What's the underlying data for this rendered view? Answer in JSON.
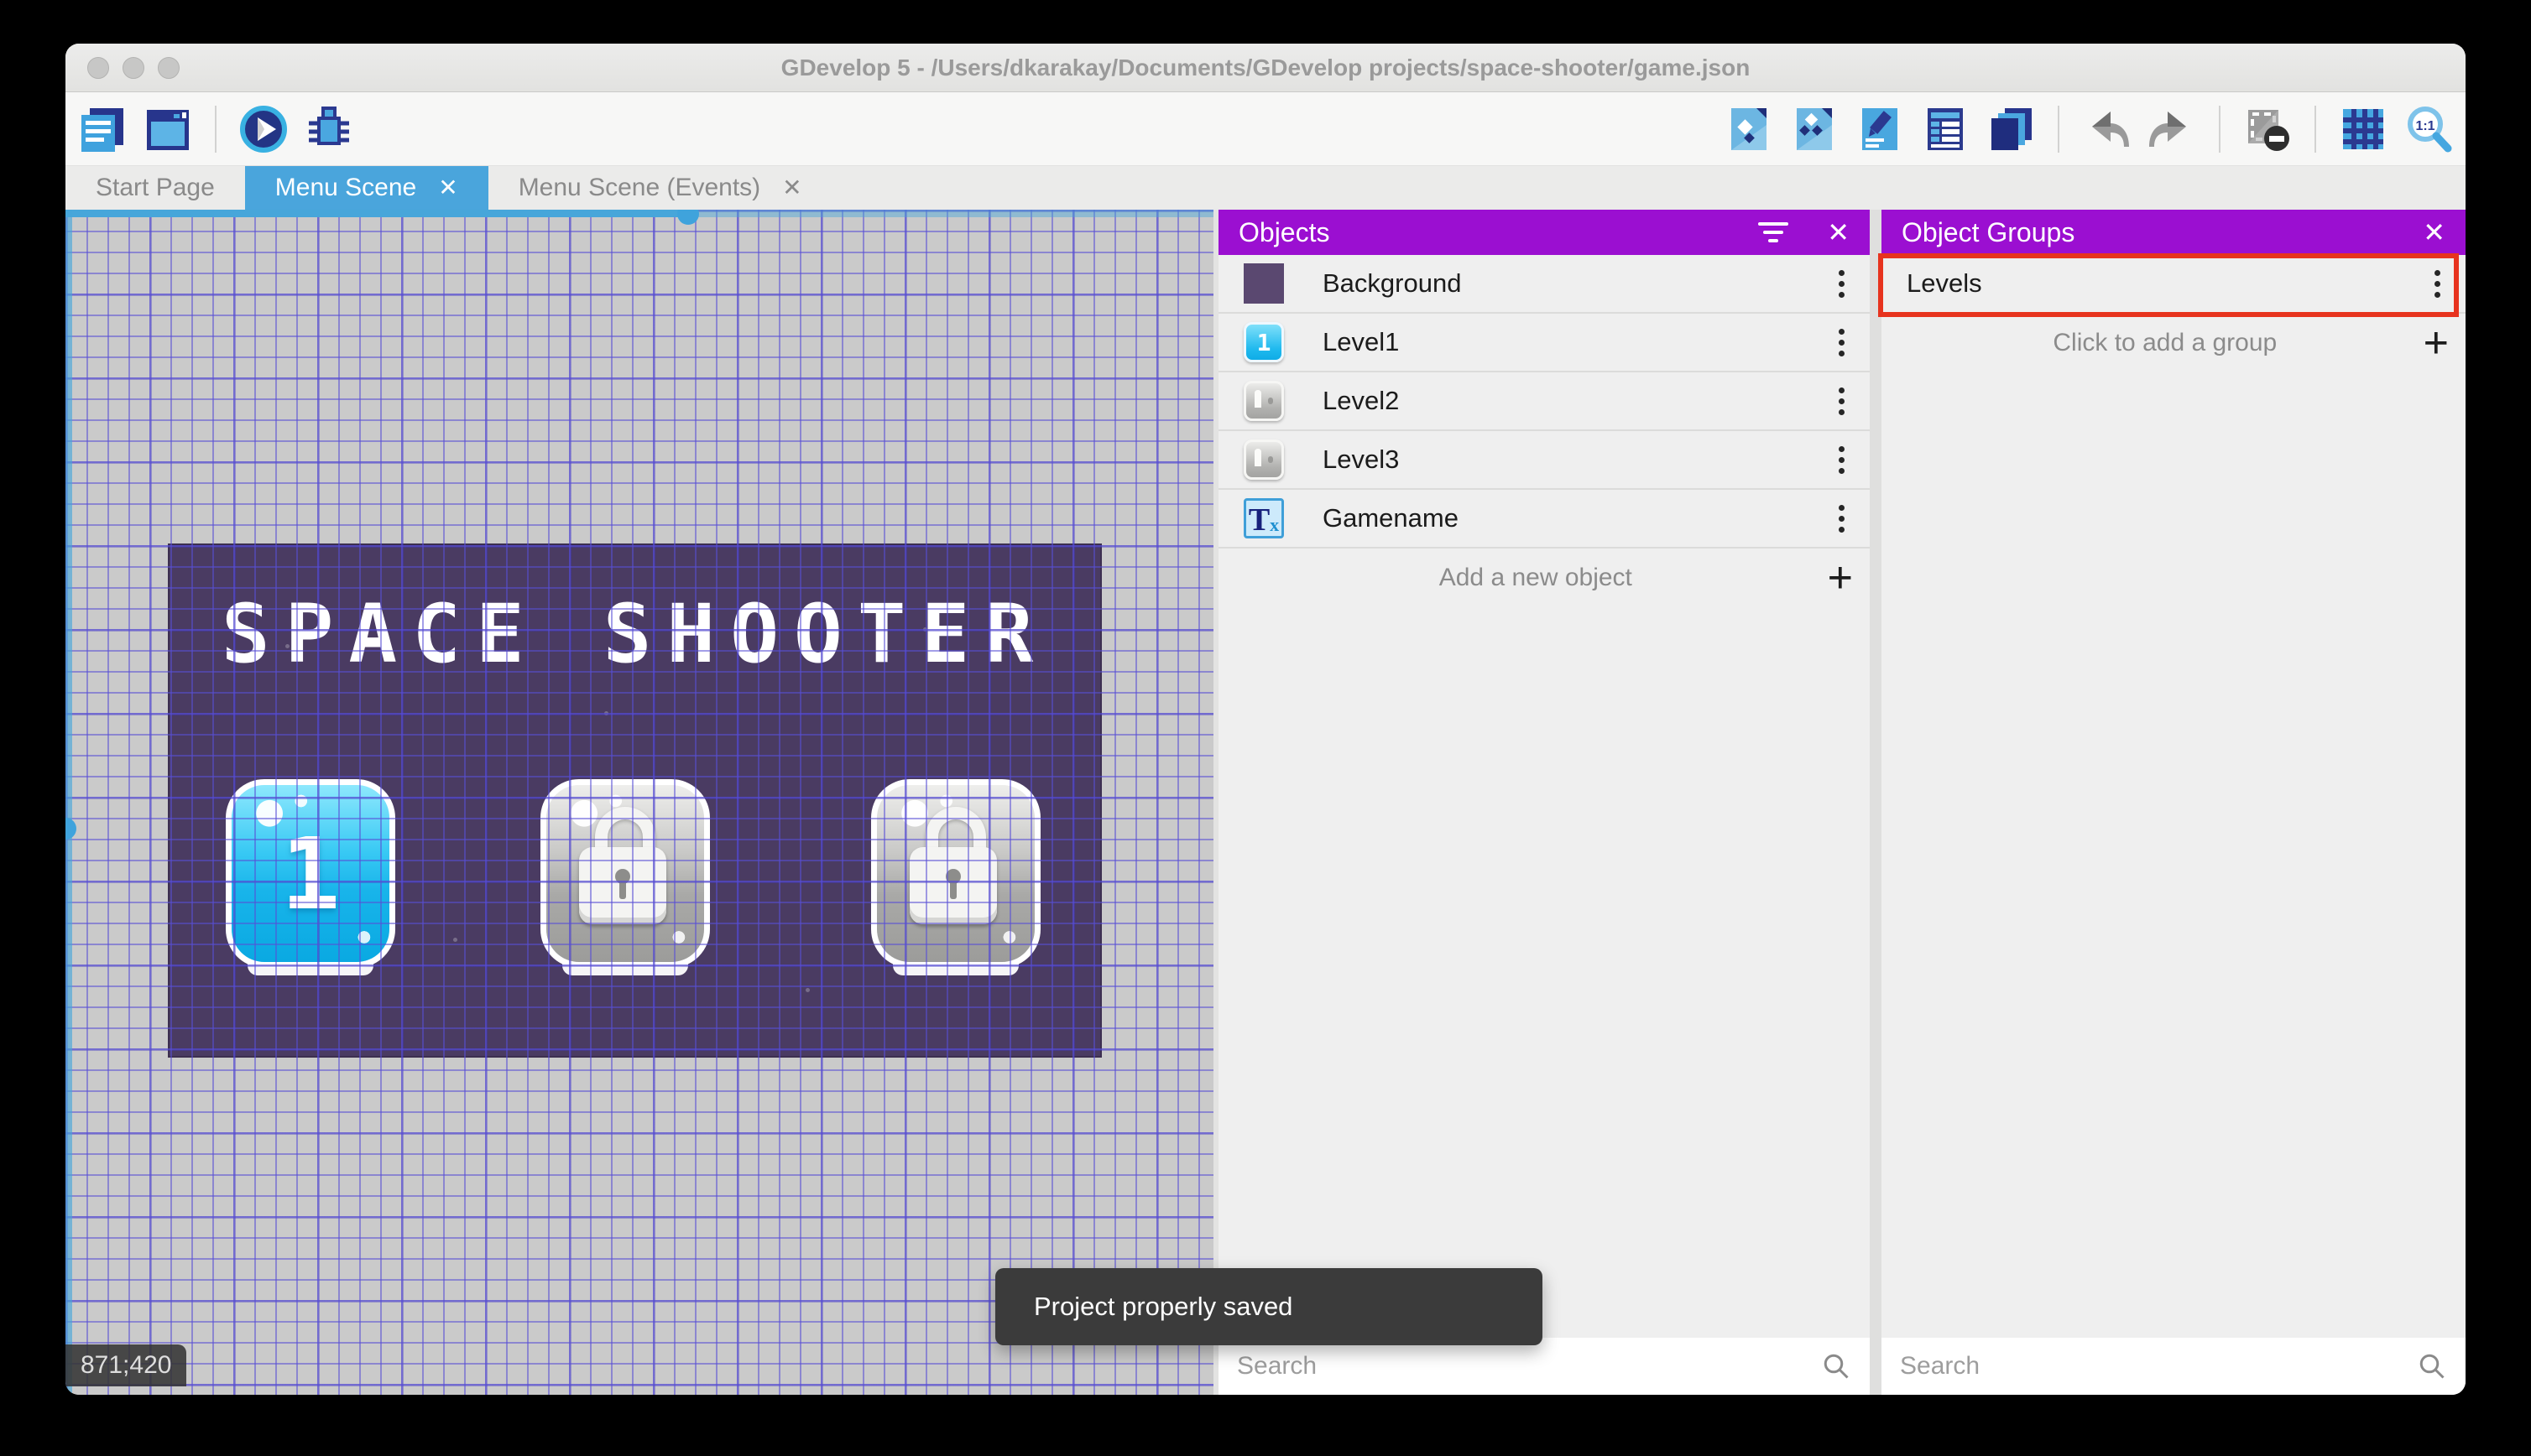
{
  "window": {
    "title": "GDevelop 5 - /Users/dkarakay/Documents/GDevelop projects/space-shooter/game.json"
  },
  "tabs": [
    {
      "label": "Start Page",
      "active": false,
      "closable": false
    },
    {
      "label": "Menu Scene",
      "active": true,
      "closable": true
    },
    {
      "label": "Menu Scene (Events)",
      "active": false,
      "closable": true
    }
  ],
  "toolbar": {
    "left_icons": [
      "project-manager-icon",
      "preview-window-icon",
      "play-icon",
      "debug-icon"
    ],
    "right_icons": [
      "objects-editor-icon",
      "object-groups-editor-icon",
      "properties-icon",
      "instances-list-icon",
      "layers-icon",
      "undo-icon",
      "redo-icon",
      "render-mask-icon",
      "grid-icon",
      "zoom-original-icon"
    ]
  },
  "canvas": {
    "coordinates": "871;420",
    "scene": {
      "title": "SPACE SHOOTER",
      "background_color": "#4a3b62",
      "buttons": [
        {
          "label": "1",
          "state": "unlocked"
        },
        {
          "label": "",
          "state": "locked"
        },
        {
          "label": "",
          "state": "locked"
        }
      ]
    }
  },
  "objects_panel": {
    "title": "Objects",
    "items": [
      {
        "label": "Background",
        "thumb": "background-swatch"
      },
      {
        "label": "Level1",
        "thumb": "blue-button-1"
      },
      {
        "label": "Level2",
        "thumb": "gray-lock-button"
      },
      {
        "label": "Level3",
        "thumb": "gray-lock-button"
      },
      {
        "label": "Gamename",
        "thumb": "text-object"
      }
    ],
    "add_label": "Add a new object",
    "search_placeholder": "Search"
  },
  "groups_panel": {
    "title": "Object Groups",
    "items": [
      {
        "label": "Levels",
        "highlighted": true
      }
    ],
    "add_label": "Click to add a group",
    "search_placeholder": "Search"
  },
  "toast": {
    "message": "Project properly saved"
  },
  "colors": {
    "header_purple": "#9b0fd1",
    "active_tab_blue": "#4aa5dc",
    "annotation_red": "#e7331e",
    "toast_bg": "#3b3b3b",
    "scene_purple": "#4a3b62",
    "button_cyan": "#2fc4f3",
    "grid_line": "#584ed6"
  }
}
